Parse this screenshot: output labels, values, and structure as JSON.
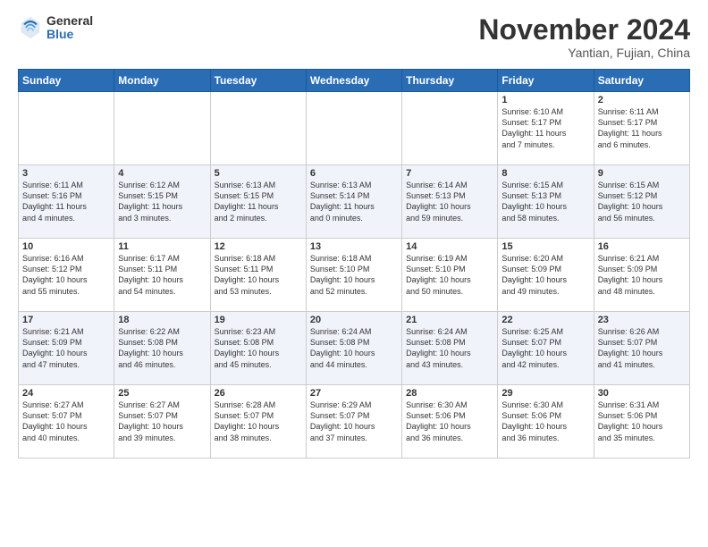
{
  "logo": {
    "general": "General",
    "blue": "Blue"
  },
  "header": {
    "month": "November 2024",
    "location": "Yantian, Fujian, China"
  },
  "days_of_week": [
    "Sunday",
    "Monday",
    "Tuesday",
    "Wednesday",
    "Thursday",
    "Friday",
    "Saturday"
  ],
  "weeks": [
    [
      {
        "day": "",
        "info": ""
      },
      {
        "day": "",
        "info": ""
      },
      {
        "day": "",
        "info": ""
      },
      {
        "day": "",
        "info": ""
      },
      {
        "day": "",
        "info": ""
      },
      {
        "day": "1",
        "info": "Sunrise: 6:10 AM\nSunset: 5:17 PM\nDaylight: 11 hours\nand 7 minutes."
      },
      {
        "day": "2",
        "info": "Sunrise: 6:11 AM\nSunset: 5:17 PM\nDaylight: 11 hours\nand 6 minutes."
      }
    ],
    [
      {
        "day": "3",
        "info": "Sunrise: 6:11 AM\nSunset: 5:16 PM\nDaylight: 11 hours\nand 4 minutes."
      },
      {
        "day": "4",
        "info": "Sunrise: 6:12 AM\nSunset: 5:15 PM\nDaylight: 11 hours\nand 3 minutes."
      },
      {
        "day": "5",
        "info": "Sunrise: 6:13 AM\nSunset: 5:15 PM\nDaylight: 11 hours\nand 2 minutes."
      },
      {
        "day": "6",
        "info": "Sunrise: 6:13 AM\nSunset: 5:14 PM\nDaylight: 11 hours\nand 0 minutes."
      },
      {
        "day": "7",
        "info": "Sunrise: 6:14 AM\nSunset: 5:13 PM\nDaylight: 10 hours\nand 59 minutes."
      },
      {
        "day": "8",
        "info": "Sunrise: 6:15 AM\nSunset: 5:13 PM\nDaylight: 10 hours\nand 58 minutes."
      },
      {
        "day": "9",
        "info": "Sunrise: 6:15 AM\nSunset: 5:12 PM\nDaylight: 10 hours\nand 56 minutes."
      }
    ],
    [
      {
        "day": "10",
        "info": "Sunrise: 6:16 AM\nSunset: 5:12 PM\nDaylight: 10 hours\nand 55 minutes."
      },
      {
        "day": "11",
        "info": "Sunrise: 6:17 AM\nSunset: 5:11 PM\nDaylight: 10 hours\nand 54 minutes."
      },
      {
        "day": "12",
        "info": "Sunrise: 6:18 AM\nSunset: 5:11 PM\nDaylight: 10 hours\nand 53 minutes."
      },
      {
        "day": "13",
        "info": "Sunrise: 6:18 AM\nSunset: 5:10 PM\nDaylight: 10 hours\nand 52 minutes."
      },
      {
        "day": "14",
        "info": "Sunrise: 6:19 AM\nSunset: 5:10 PM\nDaylight: 10 hours\nand 50 minutes."
      },
      {
        "day": "15",
        "info": "Sunrise: 6:20 AM\nSunset: 5:09 PM\nDaylight: 10 hours\nand 49 minutes."
      },
      {
        "day": "16",
        "info": "Sunrise: 6:21 AM\nSunset: 5:09 PM\nDaylight: 10 hours\nand 48 minutes."
      }
    ],
    [
      {
        "day": "17",
        "info": "Sunrise: 6:21 AM\nSunset: 5:09 PM\nDaylight: 10 hours\nand 47 minutes."
      },
      {
        "day": "18",
        "info": "Sunrise: 6:22 AM\nSunset: 5:08 PM\nDaylight: 10 hours\nand 46 minutes."
      },
      {
        "day": "19",
        "info": "Sunrise: 6:23 AM\nSunset: 5:08 PM\nDaylight: 10 hours\nand 45 minutes."
      },
      {
        "day": "20",
        "info": "Sunrise: 6:24 AM\nSunset: 5:08 PM\nDaylight: 10 hours\nand 44 minutes."
      },
      {
        "day": "21",
        "info": "Sunrise: 6:24 AM\nSunset: 5:08 PM\nDaylight: 10 hours\nand 43 minutes."
      },
      {
        "day": "22",
        "info": "Sunrise: 6:25 AM\nSunset: 5:07 PM\nDaylight: 10 hours\nand 42 minutes."
      },
      {
        "day": "23",
        "info": "Sunrise: 6:26 AM\nSunset: 5:07 PM\nDaylight: 10 hours\nand 41 minutes."
      }
    ],
    [
      {
        "day": "24",
        "info": "Sunrise: 6:27 AM\nSunset: 5:07 PM\nDaylight: 10 hours\nand 40 minutes."
      },
      {
        "day": "25",
        "info": "Sunrise: 6:27 AM\nSunset: 5:07 PM\nDaylight: 10 hours\nand 39 minutes."
      },
      {
        "day": "26",
        "info": "Sunrise: 6:28 AM\nSunset: 5:07 PM\nDaylight: 10 hours\nand 38 minutes."
      },
      {
        "day": "27",
        "info": "Sunrise: 6:29 AM\nSunset: 5:07 PM\nDaylight: 10 hours\nand 37 minutes."
      },
      {
        "day": "28",
        "info": "Sunrise: 6:30 AM\nSunset: 5:06 PM\nDaylight: 10 hours\nand 36 minutes."
      },
      {
        "day": "29",
        "info": "Sunrise: 6:30 AM\nSunset: 5:06 PM\nDaylight: 10 hours\nand 36 minutes."
      },
      {
        "day": "30",
        "info": "Sunrise: 6:31 AM\nSunset: 5:06 PM\nDaylight: 10 hours\nand 35 minutes."
      }
    ]
  ]
}
